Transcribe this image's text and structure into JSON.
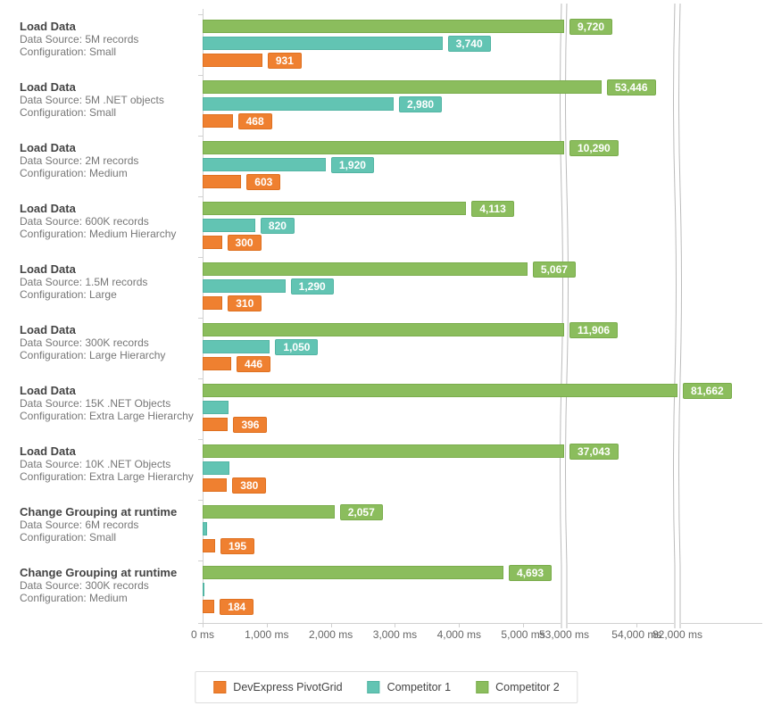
{
  "chart_data": {
    "type": "bar",
    "orientation": "horizontal",
    "xlabel": "",
    "ylabel": "",
    "x_unit": "ms",
    "axis_breaks": [
      {
        "from": 5500,
        "to": 53000
      },
      {
        "from": 54500,
        "to": 82000
      }
    ],
    "x_ticks": [
      {
        "value": 0,
        "label": "0 ms"
      },
      {
        "value": 1000,
        "label": "1,000 ms"
      },
      {
        "value": 2000,
        "label": "2,000 ms"
      },
      {
        "value": 3000,
        "label": "3,000 ms"
      },
      {
        "value": 4000,
        "label": "4,000 ms"
      },
      {
        "value": 5000,
        "label": "5,000 ms"
      },
      {
        "value": 53000,
        "label": "53,000 ms"
      },
      {
        "value": 54000,
        "label": "54,000 ms"
      },
      {
        "value": 82000,
        "label": "82,000 ms"
      }
    ],
    "series": [
      {
        "name": "DevExpress PivotGrid",
        "color": "#ef8030"
      },
      {
        "name": "Competitor 1",
        "color": "#62c4b3"
      },
      {
        "name": "Competitor 2",
        "color": "#8bbd5d"
      }
    ],
    "categories": [
      {
        "title": "Load Data",
        "line1": "Data Source: 5M records",
        "line2": "Configuration: Small",
        "values": {
          "DevExpress PivotGrid": 931,
          "Competitor 1": 3740,
          "Competitor 2": 9720
        },
        "labels": {
          "DevExpress PivotGrid": "931",
          "Competitor 1": "3,740",
          "Competitor 2": "9,720"
        }
      },
      {
        "title": "Load Data",
        "line1": "Data Source: 5M .NET objects",
        "line2": "Configuration: Small",
        "values": {
          "DevExpress PivotGrid": 468,
          "Competitor 1": 2980,
          "Competitor 2": 53446
        },
        "labels": {
          "DevExpress PivotGrid": "468",
          "Competitor 1": "2,980",
          "Competitor 2": "53,446"
        }
      },
      {
        "title": "Load Data",
        "line1": "Data Source: 2M records",
        "line2": "Configuration: Medium",
        "values": {
          "DevExpress PivotGrid": 603,
          "Competitor 1": 1920,
          "Competitor 2": 10290
        },
        "labels": {
          "DevExpress PivotGrid": "603",
          "Competitor 1": "1,920",
          "Competitor 2": "10,290"
        }
      },
      {
        "title": "Load Data",
        "line1": "Data Source: 600K records",
        "line2": "Configuration: Medium Hierarchy",
        "values": {
          "DevExpress PivotGrid": 300,
          "Competitor 1": 820,
          "Competitor 2": 4113
        },
        "labels": {
          "DevExpress PivotGrid": "300",
          "Competitor 1": "820",
          "Competitor 2": "4,113"
        }
      },
      {
        "title": "Load Data",
        "line1": "Data Source: 1.5M records",
        "line2": "Configuration: Large",
        "values": {
          "DevExpress PivotGrid": 310,
          "Competitor 1": 1290,
          "Competitor 2": 5067
        },
        "labels": {
          "DevExpress PivotGrid": "310",
          "Competitor 1": "1,290",
          "Competitor 2": "5,067"
        }
      },
      {
        "title": "Load Data",
        "line1": "Data Source: 300K records",
        "line2": "Configuration: Large Hierarchy",
        "values": {
          "DevExpress PivotGrid": 446,
          "Competitor 1": 1050,
          "Competitor 2": 11906
        },
        "labels": {
          "DevExpress PivotGrid": "446",
          "Competitor 1": "1,050",
          "Competitor 2": "11,906"
        }
      },
      {
        "title": "Load Data",
        "line1": "Data Source: 15K .NET Objects",
        "line2": "Configuration: Extra Large Hierarchy",
        "values": {
          "DevExpress PivotGrid": 396,
          "Competitor 1": 400,
          "Competitor 2": 81662
        },
        "labels": {
          "DevExpress PivotGrid": "396",
          "Competitor 1": "",
          "Competitor 2": "81,662"
        }
      },
      {
        "title": "Load Data",
        "line1": "Data Source: 10K .NET Objects",
        "line2": "Configuration: Extra Large Hierarchy",
        "values": {
          "DevExpress PivotGrid": 380,
          "Competitor 1": 420,
          "Competitor 2": 37043
        },
        "labels": {
          "DevExpress PivotGrid": "380",
          "Competitor 1": "",
          "Competitor 2": "37,043"
        }
      },
      {
        "title": "Change Grouping at runtime",
        "line1": "Data Source: 6M records",
        "line2": "Configuration: Small",
        "values": {
          "DevExpress PivotGrid": 195,
          "Competitor 1": 70,
          "Competitor 2": 2057
        },
        "labels": {
          "DevExpress PivotGrid": "195",
          "Competitor 1": "",
          "Competitor 2": "2,057"
        }
      },
      {
        "title": "Change Grouping at runtime",
        "line1": "Data Source: 300K records",
        "line2": "Configuration: Medium",
        "values": {
          "DevExpress PivotGrid": 184,
          "Competitor 1": 0,
          "Competitor 2": 4693
        },
        "labels": {
          "DevExpress PivotGrid": "184",
          "Competitor 1": "",
          "Competitor 2": "4,693"
        }
      }
    ]
  },
  "legend": {
    "items": [
      {
        "label": "DevExpress PivotGrid"
      },
      {
        "label": "Competitor 1"
      },
      {
        "label": "Competitor 2"
      }
    ]
  }
}
